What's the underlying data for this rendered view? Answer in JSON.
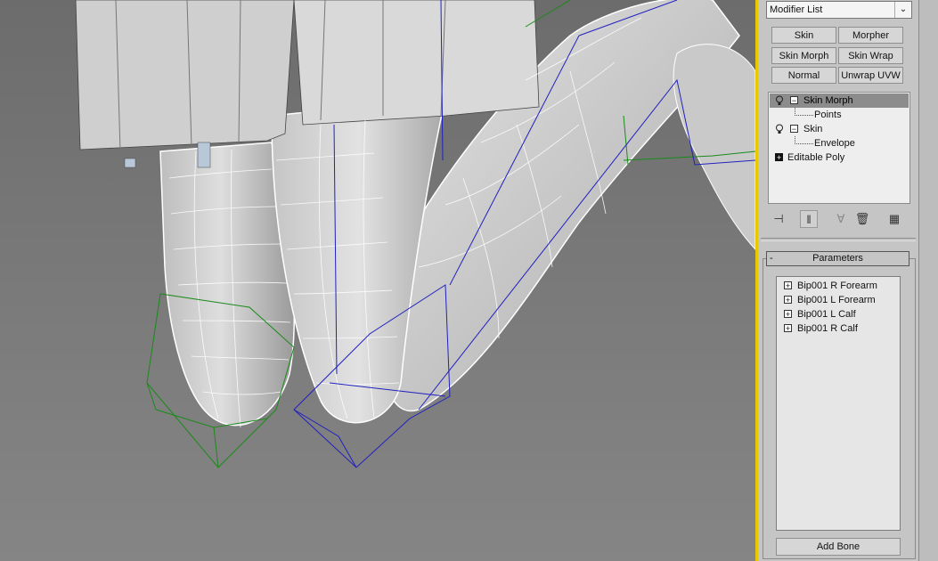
{
  "modifier_dropdown": {
    "value": "Modifier List"
  },
  "modifier_buttons": [
    {
      "label": "Skin"
    },
    {
      "label": "Morpher"
    },
    {
      "label": "Skin Morph"
    },
    {
      "label": "Skin Wrap"
    },
    {
      "label": "Normal"
    },
    {
      "label": "Unwrap UVW"
    }
  ],
  "stack": [
    {
      "label": "Skin Morph",
      "selected": true
    },
    {
      "label": "Points"
    },
    {
      "label": "Skin"
    },
    {
      "label": "Envelope"
    },
    {
      "label": "Editable Poly"
    }
  ],
  "toolbar_icons": [
    "pin-stack-icon",
    "show-end-result-icon",
    "make-unique-icon",
    "remove-modifier-icon",
    "configure-sets-icon"
  ],
  "parameters": {
    "title": "Parameters",
    "bones": [
      "Bip001 R Forearm",
      "Bip001 L Forearm",
      "Bip001 L Calf",
      "Bip001 R Calf"
    ],
    "add_bone_label": "Add Bone"
  },
  "colors": {
    "active_viewport_border": "#e8c800",
    "bone_envelope_blue": "#2020c0",
    "envelope_green": "#1a8a1a"
  }
}
